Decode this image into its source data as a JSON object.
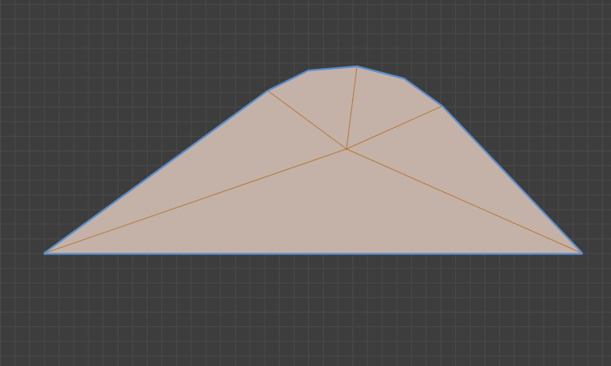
{
  "viewport": {
    "background_color": "#3d3d3d",
    "grid_line_color": "#4a4a4a",
    "grid_visible": true
  },
  "mesh": {
    "fill_color": "#c4b2a8",
    "outline_color": "#5a8fd0",
    "wire_color": "#b6793a",
    "vertex_count": 9,
    "triangle_count": 7
  }
}
